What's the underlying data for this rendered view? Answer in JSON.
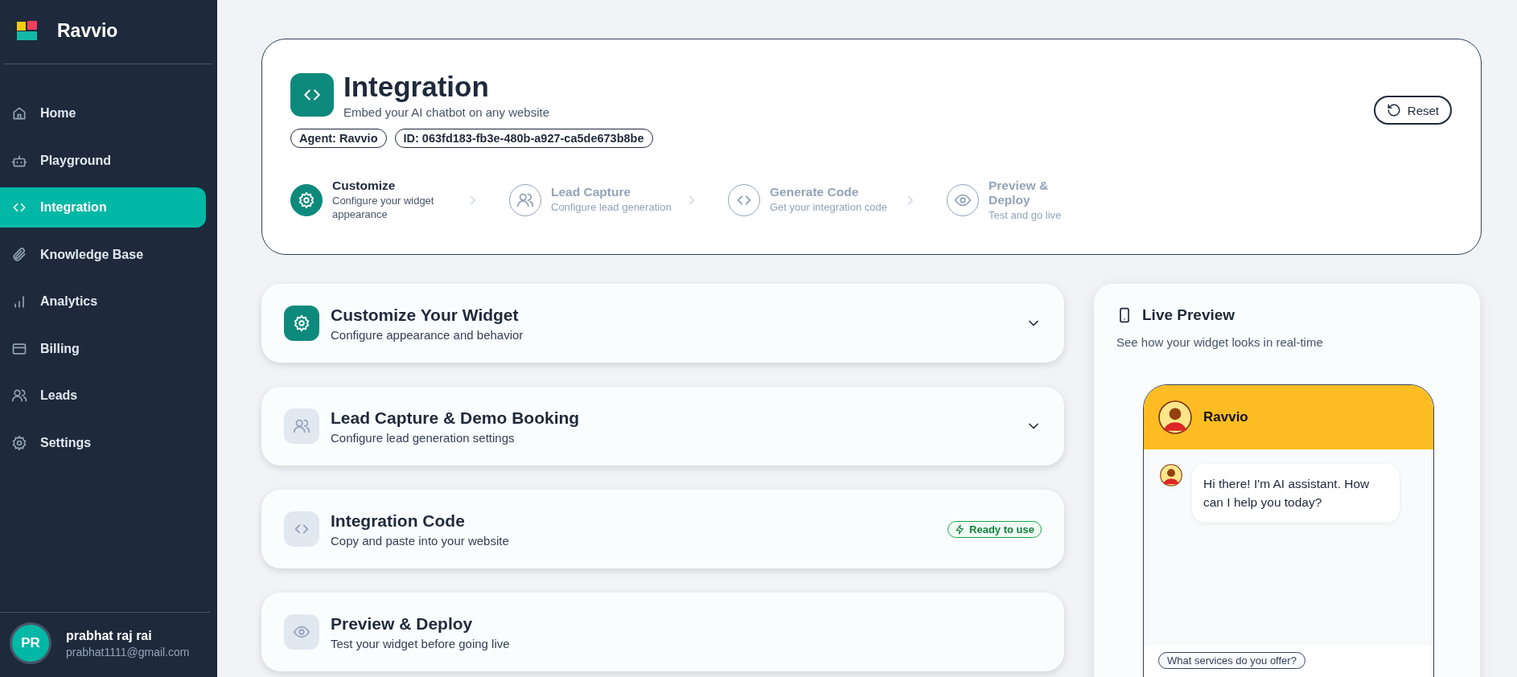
{
  "brand": {
    "name": "Ravvio"
  },
  "sidebar": {
    "items": [
      {
        "kind": "home",
        "label": "Home",
        "selected": false
      },
      {
        "kind": "bot",
        "label": "Playground",
        "selected": false
      },
      {
        "kind": "code",
        "label": "Integration",
        "selected": true
      },
      {
        "kind": "clip",
        "label": "Knowledge Base",
        "selected": false
      },
      {
        "kind": "bars",
        "label": "Analytics",
        "selected": false
      },
      {
        "kind": "card",
        "label": "Billing",
        "selected": false
      },
      {
        "kind": "users",
        "label": "Leads",
        "selected": false
      },
      {
        "kind": "gear",
        "label": "Settings",
        "selected": false
      }
    ]
  },
  "user": {
    "initials": "PR",
    "name": "prabhat raj rai",
    "email": "prabhat1111@gmail.com"
  },
  "header": {
    "title": "Integration",
    "subtitle": "Embed your AI chatbot on any website",
    "badges": [
      "Agent: Ravvio",
      "ID: 063fd183-fb3e-480b-a927-ca5de673b8be"
    ],
    "reset_button": "Reset",
    "steps": [
      {
        "kind": "gear",
        "title": "Customize",
        "description": "Configure your widget appearance",
        "active": true
      },
      {
        "kind": "users",
        "title": "Lead Capture",
        "description": "Configure lead generation",
        "active": false
      },
      {
        "kind": "code",
        "title": "Generate Code",
        "description": "Get your integration code",
        "active": false
      },
      {
        "kind": "eye",
        "title": "Preview & Deploy",
        "description": "Test and go live",
        "active": false
      }
    ]
  },
  "sections": [
    {
      "kind": "gear",
      "title": "Customize Your Widget",
      "subtitle": "Configure appearance and behavior",
      "active": true,
      "expandable": true
    },
    {
      "kind": "users",
      "title": "Lead Capture & Demo Booking",
      "subtitle": "Configure lead generation settings",
      "active": false,
      "expandable": true
    },
    {
      "kind": "code",
      "title": "Integration Code",
      "subtitle": "Copy and paste into your website",
      "active": false,
      "expandable": false,
      "badge": "Ready to use"
    },
    {
      "kind": "eye",
      "title": "Preview & Deploy",
      "subtitle": "Test your widget before going live",
      "active": false,
      "expandable": false
    }
  ],
  "preview": {
    "title": "Live Preview",
    "subtitle": "See how your widget looks in real-time",
    "widget": {
      "bot_name": "Ravvio",
      "messages": [
        "Hi there! I'm AI assistant. How can I help you today?"
      ],
      "suggestions": [
        "What services do you offer?"
      ]
    }
  }
}
